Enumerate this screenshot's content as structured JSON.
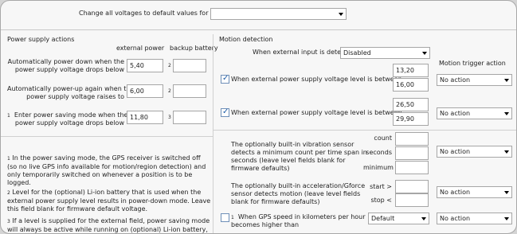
{
  "top": {
    "label": "Change all voltages to default values for",
    "select_value": ""
  },
  "power": {
    "title": "Power supply actions",
    "col_external": "external power",
    "col_backup": "backup battery",
    "rows": [
      {
        "label_line1": "Automatically power down when the",
        "label_line2": "power supply voltage drops below",
        "external": "5,40",
        "backup_note": "2",
        "backup": ""
      },
      {
        "label_line1": "Automatically power-up again when the",
        "label_line2": "power supply voltage raises to",
        "external": "6,00",
        "backup_note": "2",
        "backup": ""
      },
      {
        "label_line1": "Enter power saving mode when the",
        "label_line2": "power supply voltage drops below",
        "note": "1",
        "external": "11,80",
        "backup_note": "3",
        "backup": ""
      }
    ],
    "notes": [
      {
        "num": "1",
        "text": "In the power saving mode, the GPS receiver is switched off (so no live GPS info available for motion/region detection) and only temporarily switched on whenever a position is to be logged."
      },
      {
        "num": "2",
        "text": "Level for the (optional) Li-ion battery that is used when the external power supply level results in power-down mode. Leave this field blank for firmware default voltage."
      },
      {
        "num": "3",
        "text": "If a level is supplied for the external field, power saving mode will always be active while running on (optional) Li-ion battery, unless a level"
      }
    ]
  },
  "motion": {
    "title": "Motion detection",
    "input_label": "When external input is detected",
    "input_select": "Disabled",
    "trigger_header": "Motion trigger action",
    "rows": [
      {
        "label": "When external power supply voltage level is between",
        "checked": true,
        "val1": "13,20",
        "val2": "16,00",
        "action": "No action"
      },
      {
        "label": "When external power supply voltage level is between",
        "checked": true,
        "val1": "26,50",
        "val2": "29,90",
        "action": "No action"
      }
    ],
    "vibration": {
      "text": "The optionally built-in vibration sensor detects a minimum count per time span in seconds (leave level fields blank for firmware defaults)",
      "count_label": "count",
      "seconds_label": "seconds",
      "minimum_label": "minimum",
      "count": "",
      "seconds": "",
      "minimum": "",
      "action": "No action"
    },
    "accel": {
      "text": "The optionally built-in acceleration/Gforce sensor detects motion (leave level fields blank for firmware defaults)",
      "start_label": "start >",
      "stop_label": "stop <",
      "start": "",
      "stop": "",
      "action": "No action"
    },
    "gps": {
      "note": "1",
      "text_line1": "When GPS speed in kilometers per hour",
      "text_line2": "becomes higher than",
      "checked": false,
      "select": "Default",
      "action": "No action"
    }
  }
}
